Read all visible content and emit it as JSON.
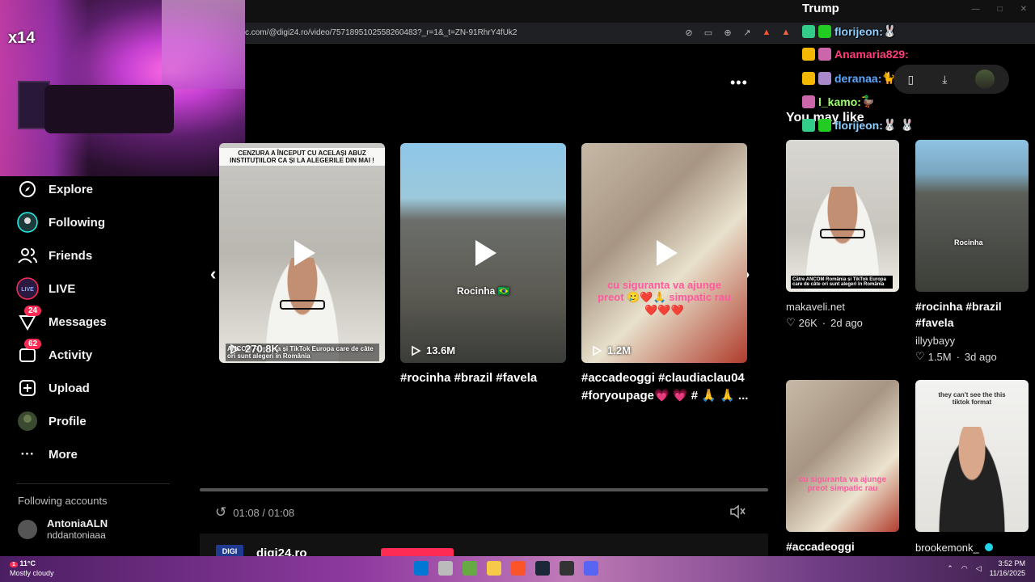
{
  "browser": {
    "url": "c.com/@digi24.ro/video/7571895102558260483?_r=1&_t=ZN-91RhrY4fUk2"
  },
  "webcam": {
    "counter": "x14"
  },
  "sidebar": {
    "items": [
      {
        "label": "Explore",
        "icon": "compass-icon"
      },
      {
        "label": "Following",
        "icon": "following-icon"
      },
      {
        "label": "Friends",
        "icon": "friends-icon"
      },
      {
        "label": "LIVE",
        "icon": "live-icon"
      },
      {
        "label": "Messages",
        "icon": "messages-icon",
        "badge": "24"
      },
      {
        "label": "Activity",
        "icon": "activity-icon",
        "badge": "62"
      },
      {
        "label": "Upload",
        "icon": "upload-icon"
      },
      {
        "label": "Profile",
        "icon": "profile-icon"
      },
      {
        "label": "More",
        "icon": "more-icon"
      }
    ],
    "following_accounts_title": "Following accounts",
    "accounts": [
      {
        "name": "AntoniaALN",
        "handle": "nddantoniaaa"
      }
    ]
  },
  "carousel": {
    "cards": [
      {
        "views": "270.8K",
        "top_caption": "CENZURA A ÎNCEPUT CU ACELAȘI ABUZ INSTITUȚIILOR CA ȘI LA ALEGERILE DIN MAI !",
        "bottom_caption": "ANCOM România și TikTok Europa care de câte ori sunt alegeri în România",
        "caption": ""
      },
      {
        "views": "13.6M",
        "overlay": "Rocinha 🇧🇷",
        "caption": "#rocinha #brazil #favela"
      },
      {
        "views": "1.2M",
        "overlay": "cu siguranta va ajunge preot 🥲❤️🙏 simpatic rau❤️❤️❤️",
        "caption": "#accadeoggi #claudiaclau04 #foryoupage💗 💗 # 🙏 🙏 ..."
      }
    ]
  },
  "player": {
    "time": "01:08 / 01:08",
    "author": "digi24.ro",
    "author_logo": "DIGI"
  },
  "chat": {
    "title": "Trump",
    "lines": [
      {
        "user": "florijeon:",
        "color": "#8fd0ff",
        "text": "🐰 "
      },
      {
        "user": "Anamaria829:",
        "color": "#ff3b7a",
        "text": ""
      },
      {
        "user": "deranaa:",
        "color": "#5aa8ff",
        "text": "🐈"
      },
      {
        "user": "l_kamo:",
        "color": "#9cff6b",
        "text": "🦆"
      },
      {
        "user": "florijeon:",
        "color": "#8fd0ff",
        "text": "🐰 🐰"
      }
    ]
  },
  "recommended": {
    "title": "You may like",
    "items": [
      {
        "author": "makaveli.net",
        "likes": "26K",
        "ago": "2d ago",
        "overlay": "Către ANCOM România și TikTok Europa care de câte ori sunt alegeri în România"
      },
      {
        "title": "#rocinha #brazil #favela",
        "author": "illyybayy",
        "likes": "1.5M",
        "ago": "3d ago",
        "overlay": "Rocinha"
      },
      {
        "title": "#accadeoggi",
        "overlay": "cu siguranta va ajunge preot simpatic rau"
      },
      {
        "author": "brookemonk_",
        "overlay": "they can't see the this tiktok format"
      }
    ]
  },
  "taskbar": {
    "temperature": "11°C",
    "weather": "Mostly cloudy",
    "weather_badge": "1",
    "time": "3:52 PM",
    "date": "11/16/2025"
  },
  "colors": {
    "accent": "#fe2c55",
    "background": "#000000"
  }
}
